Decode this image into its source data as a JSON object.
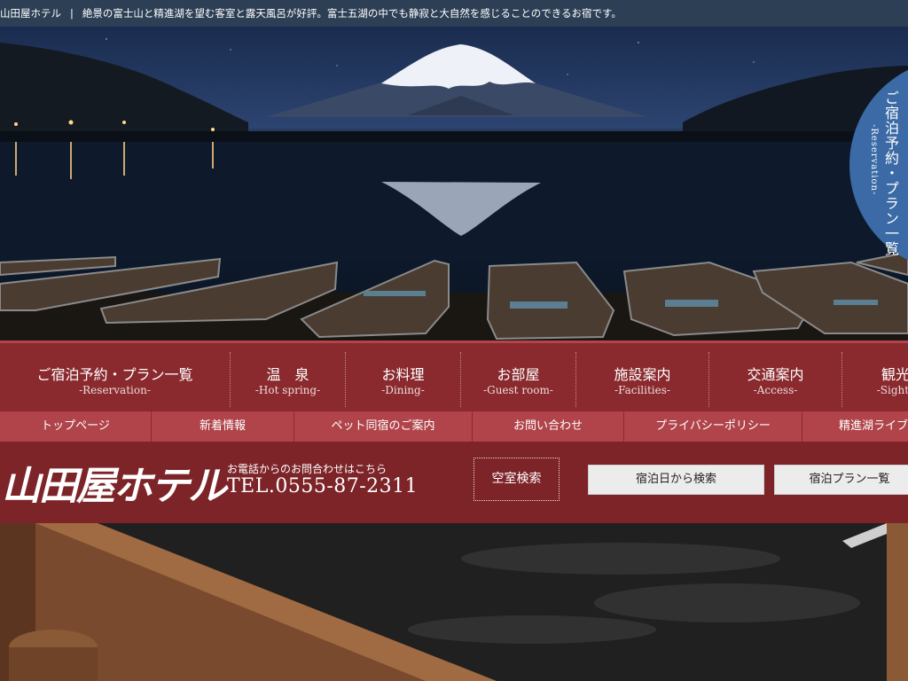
{
  "topbar": {
    "site_name": "山田屋ホテル",
    "separator": "|",
    "tagline": "絶景の富士山と精進湖を望む客室と露天風呂が好評。富士五湖の中でも静寂と大自然を感じることのできるお宿です。"
  },
  "reserve_tab": {
    "label": "ご宿泊予約・プラン一覧",
    "sub": "-Reservation-"
  },
  "main_nav": [
    {
      "ja": "ご宿泊予約・プラン一覧",
      "en": "-Reservation-"
    },
    {
      "ja": "温　泉",
      "en": "-Hot spring-"
    },
    {
      "ja": "お料理",
      "en": "-Dining-"
    },
    {
      "ja": "お部屋",
      "en": "-Guest room-"
    },
    {
      "ja": "施設案内",
      "en": "-Facilities-"
    },
    {
      "ja": "交通案内",
      "en": "-Access-"
    },
    {
      "ja": "観光",
      "en": "-Sights"
    }
  ],
  "sub_nav": [
    {
      "label": "トップページ"
    },
    {
      "label": "新着情報"
    },
    {
      "label": "ペット同宿のご案内"
    },
    {
      "label": "お問い合わせ"
    },
    {
      "label": "プライバシーポリシー"
    },
    {
      "label": "精進湖ライブ"
    }
  ],
  "band": {
    "logo": "山田屋ホテル",
    "tel_note": "お電話からのお問合わせはこちら",
    "tel": "TEL.0555-87-2311",
    "vacancy": "空室検索",
    "search_by_date": "宿泊日から検索",
    "search_by_plan": "宿泊プラン一覧"
  },
  "colors": {
    "topbar": "#2d3f55",
    "main_nav": "#8a2a2e",
    "sub_nav": "#b0444a",
    "band": "#7d2429",
    "reserve_tab": "#3b6aa6"
  }
}
